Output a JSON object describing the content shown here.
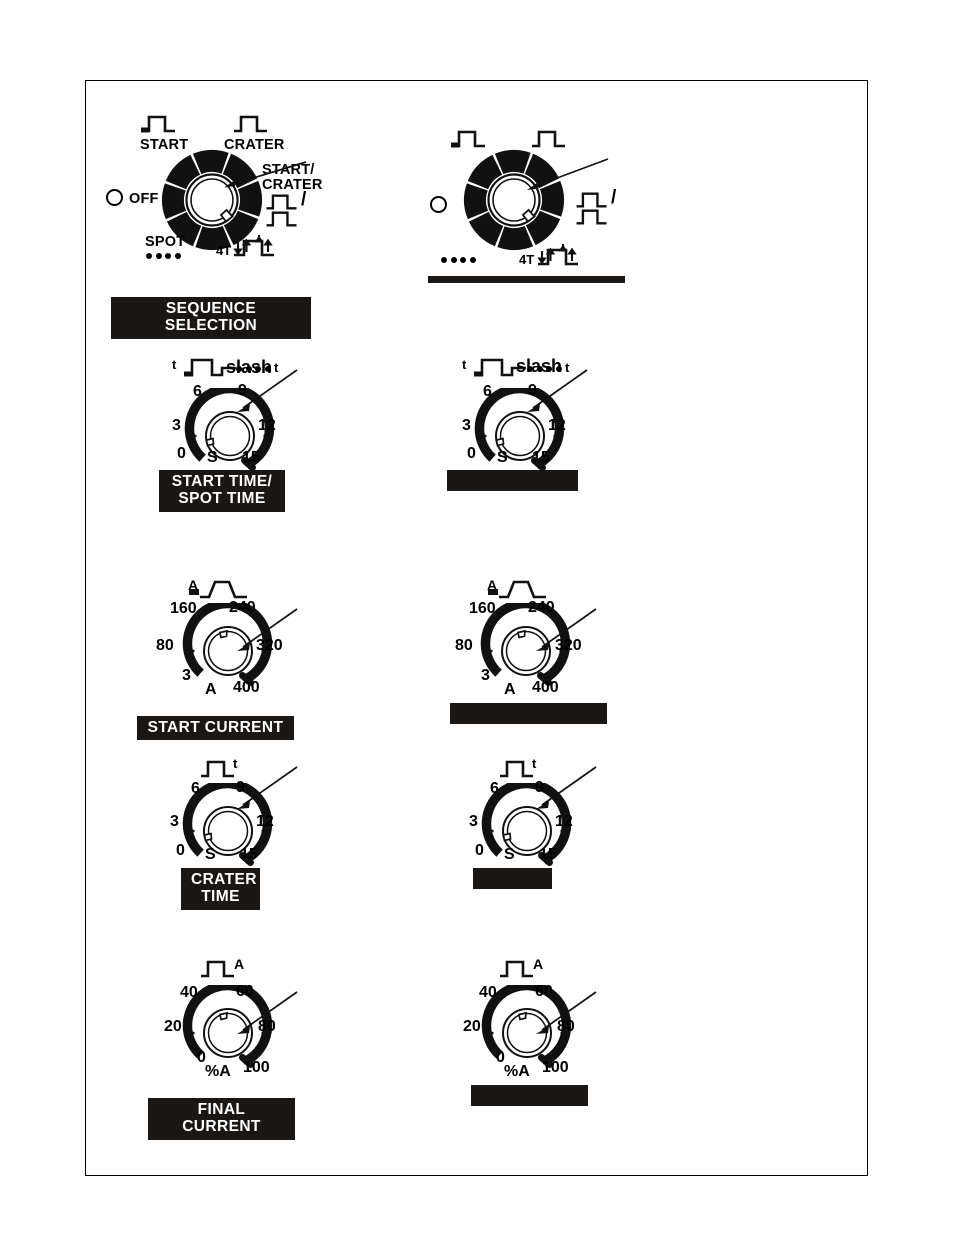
{
  "page": {
    "background": "#ffffff",
    "frame_color": "#000000",
    "ink": "#000000",
    "caption_bg": "#1a1715",
    "caption_fg": "#ffffff"
  },
  "controls": [
    {
      "id": "sequence-selection",
      "type": "rotary-selector",
      "caption": "SEQUENCE SELECTION",
      "caption_blank": false,
      "positions": [
        {
          "label": "START",
          "icon": "pulse-start-waveform"
        },
        {
          "label": "CRATER",
          "icon": "pulse-crater-waveform"
        },
        {
          "label": "START/\nCRATER",
          "icon": "pulse-start-crater-waveform"
        },
        {
          "label": "4T",
          "icon": "four-t-waveform"
        },
        {
          "label": "SPOT",
          "icon": "four-dots"
        },
        {
          "label": "OFF",
          "icon": "off-circle"
        }
      ],
      "slash_symbol": "/",
      "selected_index": 2
    },
    {
      "id": "start-time-spot-time",
      "type": "dial",
      "caption": "START TIME/\nSPOT TIME",
      "caption_blank": false,
      "header_icons": [
        "t-ramp-down-waveform",
        "slash",
        "four-dots-t"
      ],
      "header_left_unit": "t",
      "header_right_unit": "t",
      "scale": [
        "0",
        "3",
        "6",
        "9",
        "12",
        "15"
      ],
      "unit": "S",
      "arc_start_value": "0",
      "arc_end_value": "15"
    },
    {
      "id": "start-current",
      "type": "dial",
      "caption": "START CURRENT",
      "caption_blank": false,
      "header_icons": [
        "a-ramp-pulse-waveform"
      ],
      "header_left_unit": "A",
      "scale": [
        "3",
        "80",
        "160",
        "240",
        "320",
        "400"
      ],
      "unit": "A",
      "arc_start_value": "3",
      "arc_end_value": "400"
    },
    {
      "id": "crater-time",
      "type": "dial",
      "caption": "CRATER\nTIME",
      "caption_blank": false,
      "header_icons": [
        "pulse-t-waveform"
      ],
      "header_right_unit": "t",
      "scale": [
        "0",
        "3",
        "6",
        "9",
        "12",
        "15"
      ],
      "unit": "S",
      "arc_start_value": "0",
      "arc_end_value": "15"
    },
    {
      "id": "final-current",
      "type": "dial",
      "caption": "FINAL CURRENT",
      "caption_blank": false,
      "header_icons": [
        "pulse-a-waveform"
      ],
      "header_right_unit": "A",
      "scale": [
        "0",
        "20",
        "40",
        "60",
        "80",
        "100"
      ],
      "unit": "%A",
      "arc_start_value": "0",
      "arc_end_value": "100"
    },
    {
      "id": "sequence-selection-unlabeled",
      "type": "rotary-selector",
      "caption": "",
      "caption_blank": true,
      "positions": [
        {
          "label": "",
          "icon": "pulse-start-waveform"
        },
        {
          "label": "",
          "icon": "pulse-crater-waveform"
        },
        {
          "label": "",
          "icon": "pulse-start-crater-waveform"
        },
        {
          "label": "4T",
          "icon": "four-t-waveform"
        },
        {
          "label": "",
          "icon": "four-dots"
        },
        {
          "label": "",
          "icon": "off-circle"
        }
      ],
      "slash_symbol": "/",
      "selected_index": 2
    },
    {
      "id": "start-time-spot-time-unlabeled",
      "type": "dial",
      "caption": "",
      "caption_blank": true,
      "header_icons": [
        "t-ramp-down-waveform",
        "slash",
        "four-dots-t"
      ],
      "header_left_unit": "t",
      "header_right_unit": "t",
      "scale": [
        "0",
        "3",
        "6",
        "9",
        "12",
        "15"
      ],
      "unit": "S",
      "arc_start_value": "0",
      "arc_end_value": "15"
    },
    {
      "id": "start-current-unlabeled",
      "type": "dial",
      "caption": "",
      "caption_blank": true,
      "header_icons": [
        "a-ramp-pulse-waveform"
      ],
      "header_left_unit": "A",
      "scale": [
        "3",
        "80",
        "160",
        "240",
        "320",
        "400"
      ],
      "unit": "A",
      "arc_start_value": "3",
      "arc_end_value": "400"
    },
    {
      "id": "crater-time-unlabeled",
      "type": "dial",
      "caption": "",
      "caption_blank": true,
      "header_icons": [
        "pulse-t-waveform"
      ],
      "header_right_unit": "t",
      "scale": [
        "0",
        "3",
        "6",
        "9",
        "12",
        "15"
      ],
      "unit": "S",
      "arc_start_value": "0",
      "arc_end_value": "15"
    },
    {
      "id": "final-current-unlabeled",
      "type": "dial",
      "caption": "",
      "caption_blank": true,
      "header_icons": [
        "pulse-a-waveform"
      ],
      "header_right_unit": "A",
      "scale": [
        "0",
        "20",
        "40",
        "60",
        "80",
        "100"
      ],
      "unit": "%A",
      "arc_start_value": "0",
      "arc_end_value": "100"
    }
  ]
}
